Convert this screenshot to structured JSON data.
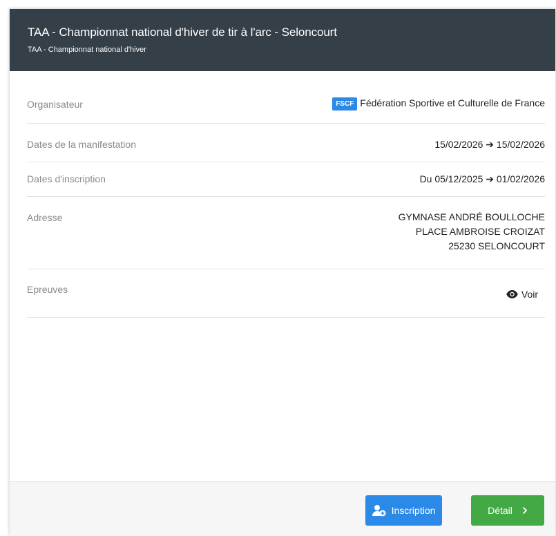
{
  "header": {
    "title": "TAA - Championnat national d'hiver de tir à l'arc - Seloncourt",
    "subtitle": "TAA - Championnat national d'hiver"
  },
  "rows": {
    "organisateur": {
      "label": "Organisateur",
      "badge": "FSCF",
      "value": "Fédération Sportive et Culturelle de France"
    },
    "dates_manifestation": {
      "label": "Dates de la manifestation",
      "value": "15/02/2026 ➔ 15/02/2026"
    },
    "dates_inscription": {
      "label": "Dates d'inscription",
      "value": "Du 05/12/2025 ➔ 01/02/2026"
    },
    "adresse": {
      "label": "Adresse",
      "lines": [
        "GYMNASE ANDRÉ BOULLOCHE",
        "PLACE AMBROISE CROIZAT",
        "25230 SELONCOURT"
      ]
    },
    "epreuves": {
      "label": "Epreuves",
      "link": "Voir",
      "icon": "eye-icon"
    }
  },
  "footer": {
    "inscription_label": "Inscription",
    "detail_label": "Détail",
    "inscription_icon": "user-plus-icon",
    "detail_icon": "chevron-right-icon"
  },
  "colors": {
    "header_bg": "#343f47",
    "primary": "#2b8ae8",
    "success": "#43a944"
  }
}
